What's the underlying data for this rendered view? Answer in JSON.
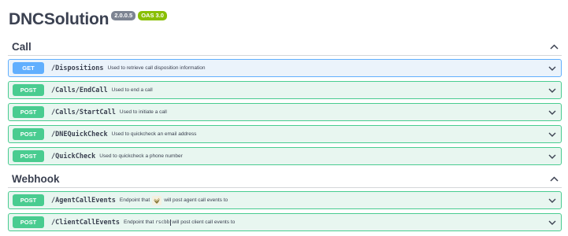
{
  "api": {
    "title": "DNCSolution",
    "version": "2.0.0.5",
    "oas": "OAS 3.0"
  },
  "sections": [
    {
      "name": "Call",
      "operations": [
        {
          "method": "GET",
          "path": "/Dispositions",
          "summary": "Used to retrieve call disposition information"
        },
        {
          "method": "POST",
          "path": "/Calls/EndCall",
          "summary": "Used to end a call"
        },
        {
          "method": "POST",
          "path": "/Calls/StartCall",
          "summary": "Used to initiate a call"
        },
        {
          "method": "POST",
          "path": "/DNEQuickCheck",
          "summary": "Used to quickcheck an email address"
        },
        {
          "method": "POST",
          "path": "/QuickCheck",
          "summary": "Used to quickcheck a phone number"
        }
      ]
    },
    {
      "name": "Webhook",
      "operations": [
        {
          "method": "POST",
          "path": "/AgentCallEvents",
          "summary_before": "Endpoint that",
          "summary_after": "will post agent call events to",
          "image_icon": "bird-logo-icon"
        },
        {
          "method": "POST",
          "path": "/ClientCallEvents",
          "summary_before": "Endpoint that",
          "summary_code": "rscbb",
          "summary_after": "will post client call events to"
        }
      ]
    }
  ],
  "colors": {
    "get": "#61affe",
    "post": "#49cc90",
    "get_bg": "#ebf3fb",
    "post_bg": "#e8f6f0",
    "version_badge": "#7d8492",
    "oas_badge": "#89bf04"
  }
}
